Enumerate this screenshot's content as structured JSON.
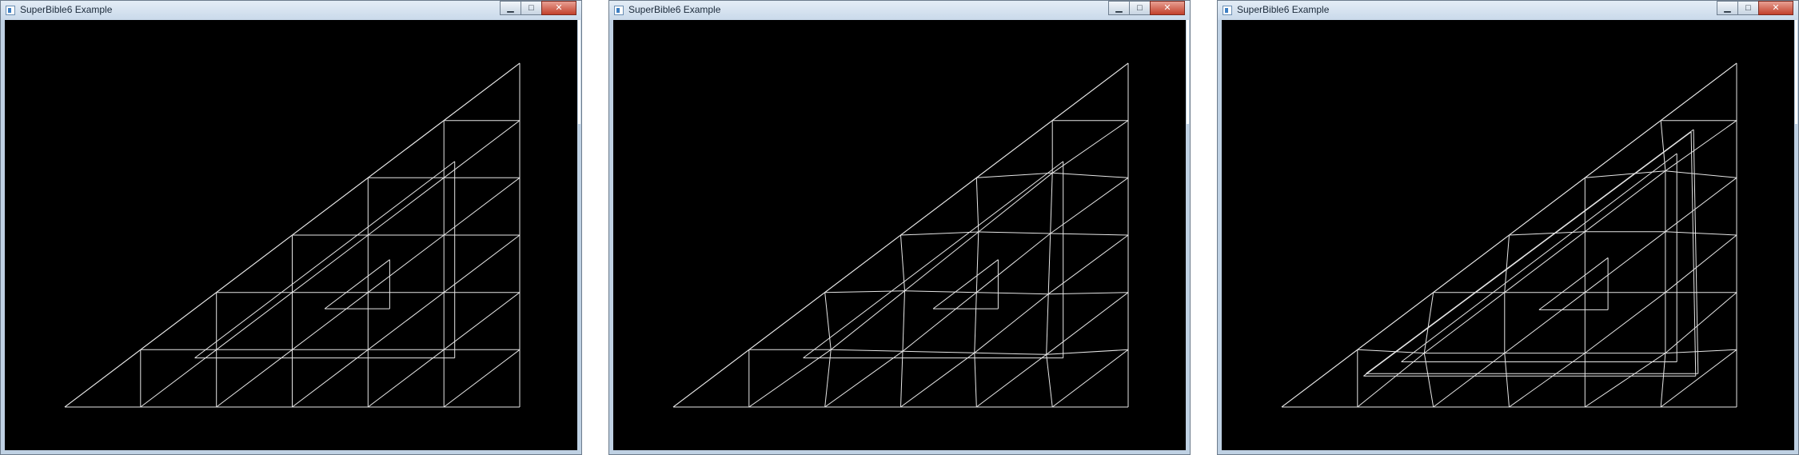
{
  "windows": [
    {
      "title": "SuperBible6 Example",
      "controls": {
        "minimize": "▁",
        "maximize": "□",
        "close": "✕"
      }
    },
    {
      "title": "SuperBible6 Example",
      "controls": {
        "minimize": "▁",
        "maximize": "□",
        "close": "✕"
      }
    },
    {
      "title": "SuperBible6 Example",
      "controls": {
        "minimize": "▁",
        "maximize": "□",
        "close": "✕"
      }
    }
  ],
  "style": {
    "background": "#000000",
    "wire_color": "#e6e6e6"
  }
}
